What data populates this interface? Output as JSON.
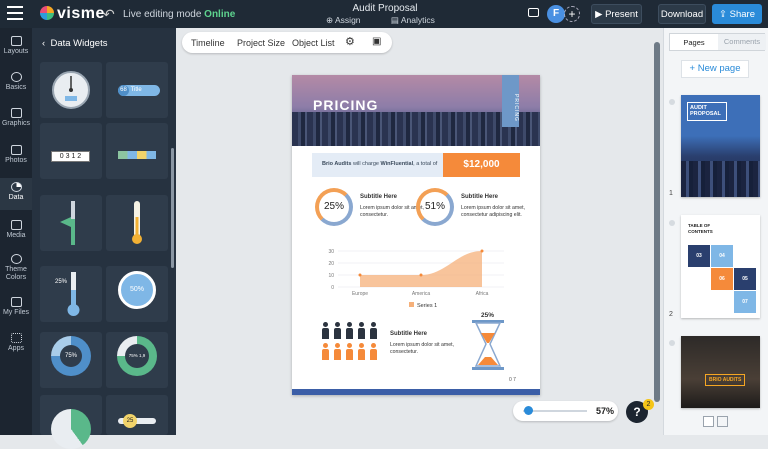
{
  "app": {
    "brand": "visme",
    "mode_label": "Live editing mode",
    "mode_status": "Online"
  },
  "document": {
    "title": "Audit Proposal",
    "assign_label": "Assign",
    "analytics_label": "Analytics"
  },
  "header_actions": {
    "avatar_initial": "F",
    "present_label": "Present",
    "download_label": "Download",
    "share_label": "Share"
  },
  "rail": {
    "items": [
      "Layouts",
      "Basics",
      "Graphics",
      "Photos",
      "Data",
      "Media",
      "Theme Colors",
      "My Files",
      "Apps"
    ]
  },
  "panel": {
    "title": "Data Widgets",
    "widgets": {
      "badge_value": "68",
      "badge_label": "Title",
      "counter_digits": "0 3 1 2",
      "thermo_value": "25%",
      "ring_value": "50%",
      "donut1_value": "75%",
      "donut2_value": "75% 1,9",
      "slider_value": "25"
    }
  },
  "toolbar": {
    "timeline": "Timeline",
    "project_size": "Project Size",
    "object_list": "Object List"
  },
  "page": {
    "hero_title": "PRICING",
    "side_tab": "PRICING",
    "intro_company": "Brio Audits",
    "intro_text": "will charge",
    "intro_client": "WinFluential",
    "intro_suffix": ", a total of",
    "price": "$12,000",
    "block1": {
      "percent": "25%",
      "subtitle": "Subtitle Here",
      "body": "Lorem ipsum dolor sit amet, consectetur."
    },
    "block2": {
      "percent": "51%",
      "subtitle": "Subtitle Here",
      "body": "Lorem ipsum dolor sit amet, consectetur adipiscing elit."
    },
    "block3": {
      "subtitle": "Subtitle Here",
      "body": "Lorem ipsum dolor sit amet, consectetur."
    },
    "hourglass_value": "25%",
    "page_number": "0 7"
  },
  "chart_data": {
    "type": "area",
    "categories": [
      "Europe",
      "America",
      "Africa"
    ],
    "series": [
      {
        "name": "Series 1",
        "values": [
          10,
          10,
          30
        ]
      }
    ],
    "ylim": [
      0,
      30
    ],
    "yticks": [
      0,
      10,
      20,
      30
    ],
    "color": "#f5b07a",
    "legend": "bottom"
  },
  "people_icons": {
    "count_dark": 5,
    "count_orange": 5,
    "dark_color": "#2c3440",
    "orange_color": "#f58a3a"
  },
  "zoom": {
    "value": "57%",
    "level": 0.05
  },
  "help": {
    "label": "?",
    "badge": "2"
  },
  "right_pane": {
    "tab_pages": "Pages",
    "tab_comments": "Comments",
    "new_page": "+ New page",
    "thumb1": {
      "number": "1",
      "title": "AUDIT PROPOSAL"
    },
    "thumb2": {
      "number": "2",
      "title": "TABLE OF CONTENTS",
      "items": [
        "03",
        "04",
        "05",
        "06",
        "07"
      ]
    },
    "thumb3": {
      "title": "BRIO AUDITS"
    }
  }
}
